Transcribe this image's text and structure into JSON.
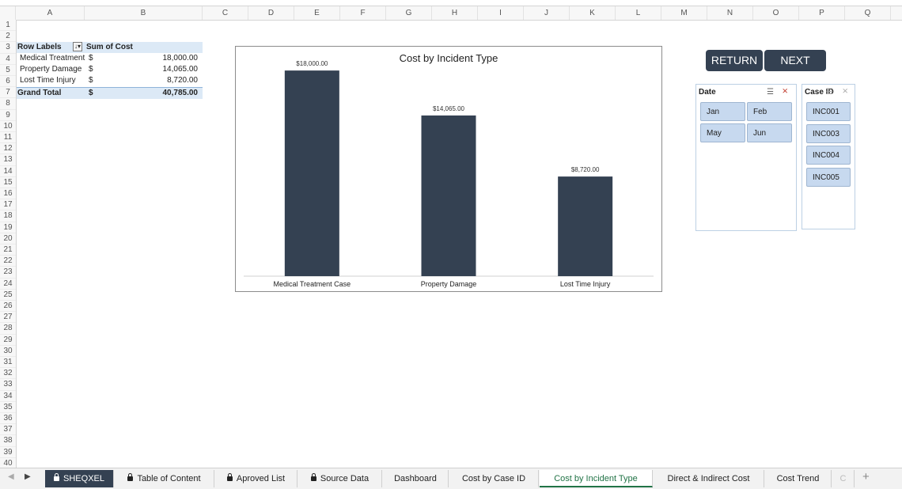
{
  "columns": [
    "A",
    "B",
    "C",
    "D",
    "E",
    "F",
    "G",
    "H",
    "I",
    "J",
    "K",
    "L",
    "M",
    "N",
    "O",
    "P",
    "Q"
  ],
  "rows": [
    "1",
    "2",
    "3",
    "4",
    "5",
    "6",
    "7",
    "8",
    "9",
    "10",
    "11",
    "12",
    "13",
    "14",
    "15",
    "16",
    "17",
    "18",
    "19",
    "20",
    "21",
    "22",
    "23",
    "24",
    "25",
    "26",
    "27",
    "28",
    "29",
    "30",
    "31",
    "32",
    "33",
    "34",
    "35",
    "36",
    "37",
    "38",
    "39",
    "40"
  ],
  "pivot": {
    "header_row_labels": "Row Labels",
    "header_sum": "Sum of Cost",
    "rows": [
      {
        "label": "Medical Treatment",
        "currency": "$",
        "value": "18,000.00"
      },
      {
        "label": "Property Damage",
        "currency": "$",
        "value": "14,065.00"
      },
      {
        "label": "Lost Time Injury",
        "currency": "$",
        "value": "8,720.00"
      }
    ],
    "total": {
      "label": "Grand Total",
      "currency": "$",
      "value": "40,785.00"
    }
  },
  "chart_data": {
    "type": "bar",
    "title": "Cost by Incident Type",
    "categories": [
      "Medical Treatment Case",
      "Property Damage",
      "Lost Time Injury"
    ],
    "values": [
      18000,
      14065,
      8720
    ],
    "labels": [
      "$18,000.00",
      "$14,065.00",
      "$8,720.00"
    ],
    "ylim": [
      0,
      20000
    ],
    "grid": false,
    "bar_color": "#344152"
  },
  "buttons": {
    "return": "RETURN",
    "next": "NEXT"
  },
  "slicer_date": {
    "title": "Date",
    "items": [
      "Jan",
      "Feb",
      "May",
      "Jun"
    ]
  },
  "slicer_case": {
    "title": "Case ID",
    "items": [
      "INC001",
      "INC003",
      "INC004",
      "INC005"
    ]
  },
  "tabs": [
    {
      "label": "SHEQXEL",
      "locked": true,
      "style": "dark"
    },
    {
      "label": "Table of Content",
      "locked": true
    },
    {
      "label": "Aproved List",
      "locked": true
    },
    {
      "label": "Source Data",
      "locked": true
    },
    {
      "label": "Dashboard",
      "locked": false
    },
    {
      "label": "Cost by Case ID",
      "locked": false
    },
    {
      "label": "Cost by Incident Type",
      "locked": false,
      "active": true
    },
    {
      "label": "Direct & Indirect Cost",
      "locked": false
    },
    {
      "label": "Cost Trend",
      "locked": false
    },
    {
      "label": "C",
      "locked": false
    }
  ],
  "tab_nav": {
    "add": "+"
  },
  "colors": {
    "accent": "#217346",
    "dark": "#344152",
    "slicer": "#c7d9ef"
  }
}
